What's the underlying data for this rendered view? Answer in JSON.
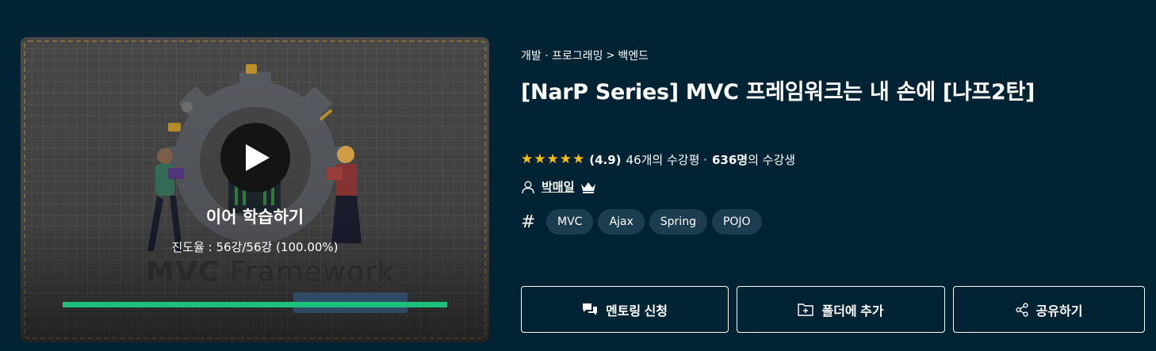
{
  "thumbnail": {
    "continue_label": "이어 학습하기",
    "progress_text": "진도율 : 56강/56강 (100.00%)",
    "progress_fraction": 1.0,
    "art_text_bold": "MVC",
    "art_text_rest": " Framework",
    "accent_color": "#1dc078"
  },
  "breadcrumb": {
    "category": "개발 · 프로그래밍",
    "separator": ">",
    "subcategory": "백엔드"
  },
  "course": {
    "title": "[NarP Series] MVC 프레임워크는 내 손에 [나프2탄]",
    "rating": "(4.9)",
    "star_count": 5,
    "reviews_text": "46개의 수강평 ·",
    "students_count": "636명",
    "students_suffix": "의 수강생",
    "instructor": "박매일"
  },
  "tags": [
    "MVC",
    "Ajax",
    "Spring",
    "POJO"
  ],
  "actions": {
    "mentoring": "멘토링 신청",
    "folder": "폴더에 추가",
    "share": "공유하기"
  },
  "colors": {
    "background": "#012333",
    "star": "#fdc000",
    "tag_bg": "#1c3d50"
  }
}
